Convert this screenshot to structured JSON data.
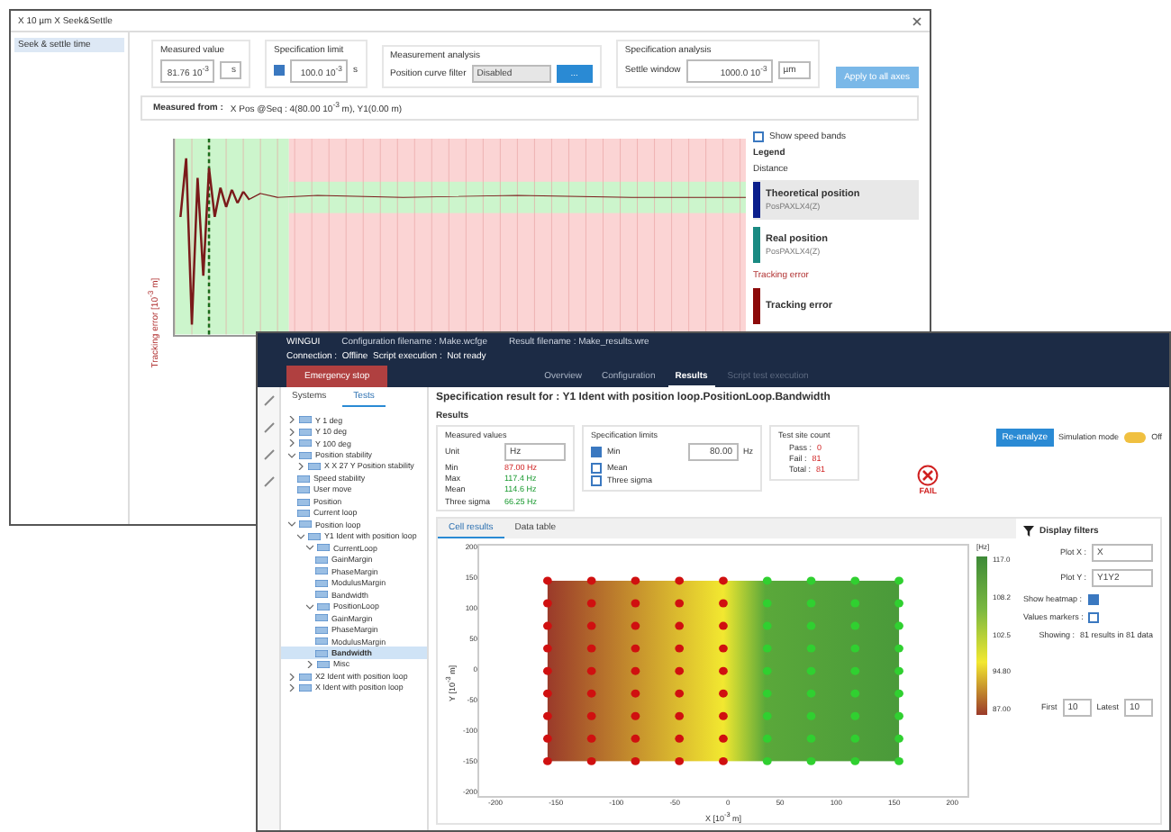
{
  "back_window": {
    "title": "X 10 µm X Seek&Settle",
    "sidebar": {
      "items": [
        {
          "label": "Seek & settle time",
          "selected": true
        }
      ]
    },
    "measured_value": {
      "label": "Measured value",
      "value": "81.76 10$^{-3}$",
      "unit": "s"
    },
    "specification_limit": {
      "label": "Specification limit",
      "checked": true,
      "value": "100.0 10$^{-3}$",
      "unit": "s"
    },
    "measurement_analysis": {
      "label": "Measurement analysis",
      "filter_label": "Position curve filter",
      "filter_value": "Disabled",
      "button": "..."
    },
    "specification_analysis": {
      "label": "Specification analysis",
      "field_label": "Settle window",
      "value": "1000.0 10$^{-3}$",
      "unit": "µm"
    },
    "apply_button": "Apply to all axes",
    "measured_from": {
      "label": "Measured from :",
      "value": "X Pos @Seq : 4(80.00 10$^{-3}$ m), Y1(0.00 m)"
    },
    "chart": {
      "ylabel": "Tracking error [10$^{-3}$ m]"
    },
    "legend": {
      "show_speed_bands": {
        "label": "Show speed bands",
        "checked": false
      },
      "title": "Legend",
      "groups": [
        {
          "name": "Distance",
          "kind": "normal",
          "items": [
            {
              "name": "Theoretical position",
              "source": "PosPAXLX4(Z)",
              "color": "#0b1f8c",
              "selected": true
            },
            {
              "name": "Real position",
              "source": "PosPAXLX4(Z)",
              "color": "#1a8a82",
              "selected": false
            }
          ]
        },
        {
          "name": "Tracking error",
          "kind": "error",
          "items": [
            {
              "name": "Tracking error",
              "color": "#8c0a0a",
              "selected": false
            }
          ]
        }
      ]
    }
  },
  "front_window": {
    "app": "WINGUI",
    "config": "Configuration filename : Make.wcfge",
    "result": "Result filename : Make_results.wre",
    "status": "Connection :  Offline  Script execution :  Not ready",
    "stop_button": "Emergency stop",
    "tabs": [
      {
        "label": "Overview",
        "selected": false,
        "disabled": false
      },
      {
        "label": "Configuration",
        "selected": false,
        "disabled": false
      },
      {
        "label": "Results",
        "selected": true,
        "disabled": false
      },
      {
        "label": "Script test execution",
        "selected": false,
        "disabled": true
      }
    ],
    "side_tabs": [
      {
        "label": "Systems",
        "selected": false
      },
      {
        "label": "Tests",
        "selected": true
      }
    ],
    "tree": [
      {
        "label": "Y 1 deg",
        "expanded": false,
        "selected": false
      },
      {
        "label": "Y 10 deg",
        "expanded": false,
        "selected": false
      },
      {
        "label": "Y 100 deg",
        "expanded": false,
        "selected": false
      },
      {
        "label": "Position stability",
        "expanded": true,
        "selected": false,
        "children": [
          {
            "label": "X X 27 Y Position stability",
            "expanded": false,
            "selected": false
          },
          {
            "label": "Speed stability",
            "selected": false
          },
          {
            "label": "User move",
            "selected": false
          },
          {
            "label": "Position",
            "selected": false
          },
          {
            "label": "Current loop",
            "selected": false
          }
        ]
      },
      {
        "label": "Position loop",
        "expanded": true,
        "selected": false,
        "children": [
          {
            "label": "Y1 Ident with position loop",
            "expanded": true,
            "selected": false,
            "children": [
              {
                "label": "CurrentLoop",
                "expanded": true,
                "selected": false,
                "children": [
                  {
                    "label": "GainMargin",
                    "selected": false
                  },
                  {
                    "label": "PhaseMargin",
                    "selected": false
                  },
                  {
                    "label": "ModulusMargin",
                    "selected": false
                  },
                  {
                    "label": "Bandwidth",
                    "selected": false
                  }
                ]
              },
              {
                "label": "PositionLoop",
                "expanded": true,
                "selected": false,
                "children": [
                  {
                    "label": "GainMargin",
                    "selected": false
                  },
                  {
                    "label": "PhaseMargin",
                    "selected": false
                  },
                  {
                    "label": "ModulusMargin",
                    "selected": false
                  },
                  {
                    "label": "Bandwidth",
                    "selected": true
                  }
                ]
              },
              {
                "label": "Misc",
                "expanded": false,
                "selected": false
              }
            ]
          }
        ]
      },
      {
        "label": "X2 Ident with position loop",
        "expanded": false,
        "selected": false
      },
      {
        "label": "X Ident with position loop",
        "expanded": false,
        "selected": false
      }
    ],
    "heading": "Specification result for : Y1 Ident with position loop.PositionLoop.Bandwidth",
    "results_title": "Results",
    "measured": {
      "title": "Measured values",
      "unit_label": "Unit",
      "unit": "Hz",
      "rows": [
        {
          "label": "Min",
          "value": "87.00 Hz",
          "kind": "fail"
        },
        {
          "label": "Max",
          "value": "117.4 Hz",
          "kind": "pass"
        },
        {
          "label": "Mean",
          "value": "114.6 Hz",
          "kind": "pass"
        },
        {
          "label": "Three sigma",
          "value": "66.25 Hz",
          "kind": "pass"
        }
      ]
    },
    "limits": {
      "title": "Specification limits",
      "rows": [
        {
          "label": "Min",
          "checked": true,
          "value": "80.00",
          "unit": "Hz"
        },
        {
          "label": "Mean",
          "checked": false
        },
        {
          "label": "Three sigma",
          "checked": false
        }
      ]
    },
    "count": {
      "title": "Test site count",
      "rows": [
        {
          "label": "Pass :",
          "value": "0"
        },
        {
          "label": "Fail :",
          "value": "81"
        },
        {
          "label": "Total :",
          "value": "81"
        }
      ]
    },
    "verdict": {
      "label": "FAIL"
    },
    "reanalyze_button": "Re-analyze",
    "simulation": {
      "label": "Simulation mode",
      "on": false,
      "state": "Off"
    },
    "chart_tabs": [
      {
        "label": "Cell results",
        "selected": true
      },
      {
        "label": "Data table",
        "selected": false
      }
    ],
    "heatmap": {
      "xlabel": "X [10$^{-3}$ m]",
      "ylabel": "Y [10$^{-3}$ m]",
      "xticks": [
        "-200",
        "-150",
        "-100",
        "-50",
        "0",
        "50",
        "100",
        "150",
        "200"
      ],
      "yticks": [
        "200",
        "150",
        "100",
        "50",
        "0",
        "-50",
        "-100",
        "-150",
        "-200"
      ],
      "scale_unit": "[Hz]",
      "scale_ticks": [
        "117.0",
        "108.2",
        "102.5",
        "94.80",
        "87.00"
      ]
    },
    "filters": {
      "title": "Display filters",
      "plot_x": {
        "label": "Plot X :",
        "value": "X"
      },
      "plot_y": {
        "label": "Plot Y :",
        "value": "Y1Y2"
      },
      "show_heatmap": {
        "label": "Show heatmap :",
        "checked": true
      },
      "values_markers": {
        "label": "Values markers :",
        "checked": false
      },
      "showing": {
        "label": "Showing :",
        "value": "81 results in 81 data"
      },
      "first": {
        "label": "First",
        "value": "10"
      },
      "latest": {
        "label": "Latest",
        "value": "10"
      }
    }
  }
}
